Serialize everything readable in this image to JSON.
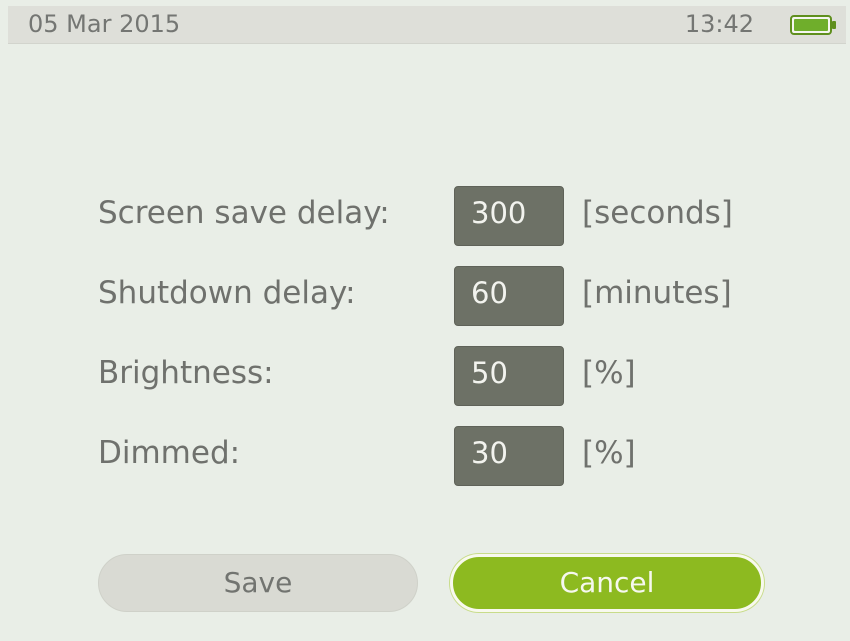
{
  "status_bar": {
    "date": "05 Mar 2015",
    "time": "13:42",
    "battery_icon": "battery-full-icon",
    "battery_color": "#6fae2b",
    "battery_level": 1.0
  },
  "settings": {
    "rows": [
      {
        "label": "Screen save delay:",
        "value": "300",
        "unit": "[seconds]"
      },
      {
        "label": "Shutdown delay:",
        "value": "60",
        "unit": "[minutes]"
      },
      {
        "label": "Brightness:",
        "value": "50",
        "unit": "[%]"
      },
      {
        "label": "Dimmed:",
        "value": "30",
        "unit": "[%]"
      }
    ]
  },
  "buttons": {
    "save_label": "Save",
    "cancel_label": "Cancel",
    "accent_color": "#8dba20"
  }
}
